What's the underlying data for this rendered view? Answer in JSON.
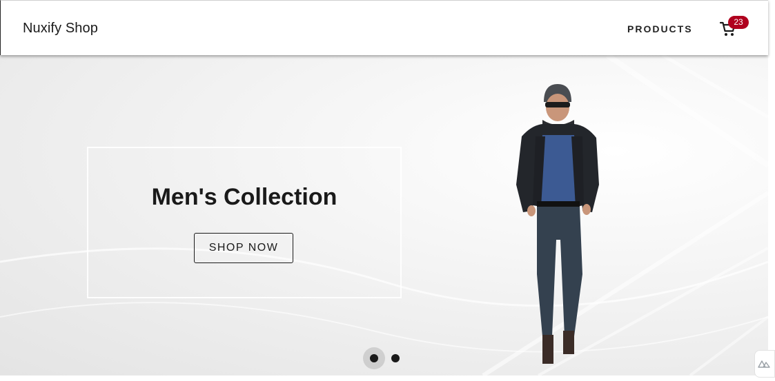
{
  "header": {
    "brand": "Nuxify Shop",
    "nav_products": "PRODUCTS",
    "cart_count": "23"
  },
  "hero": {
    "title": "Men's Collection",
    "cta_label": "SHOP NOW",
    "slide_count": 2,
    "active_slide": 1
  },
  "colors": {
    "badge": "#b0001e",
    "text": "#1a1a1a"
  },
  "icons": {
    "cart": "shopping-cart-icon",
    "devtools": "nuxt-logo-icon"
  }
}
